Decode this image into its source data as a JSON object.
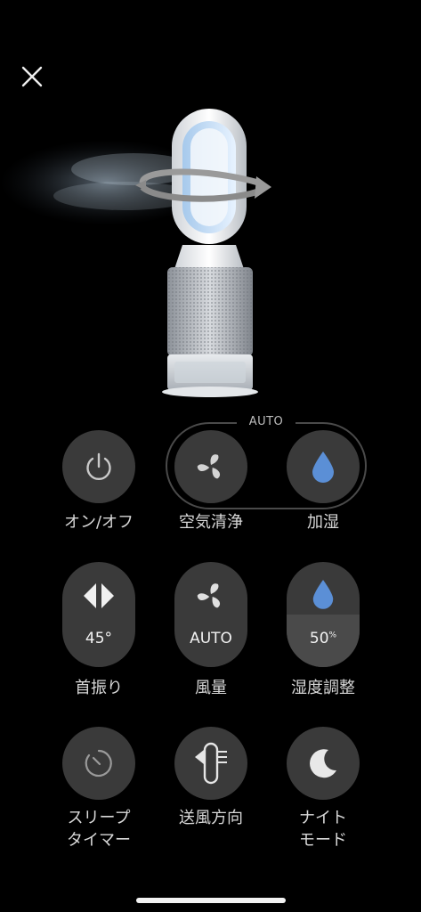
{
  "colors": {
    "background": "#000000",
    "button": "#3a3a3a",
    "accent_blue": "#5b8fd6",
    "label": "#d8d8d8"
  },
  "header": {
    "close_icon": "close-icon"
  },
  "auto_group": {
    "label": "AUTO"
  },
  "controls": {
    "power": {
      "label": "オン/オフ",
      "icon": "power-icon"
    },
    "purify": {
      "label": "空気清浄",
      "icon": "fan-icon"
    },
    "humidify": {
      "label": "加湿",
      "icon": "water-drop-icon"
    },
    "oscillation": {
      "label": "首振り",
      "value": "45°",
      "icon": "oscillation-arrows-icon"
    },
    "airflow": {
      "label": "風量",
      "value": "AUTO",
      "icon": "fan-icon"
    },
    "humidity": {
      "label": "湿度調整",
      "value": "50",
      "unit": "%",
      "level": 0.5,
      "icon": "water-drop-icon"
    },
    "sleep_timer": {
      "label": "スリープ\nタイマー",
      "icon": "timer-icon"
    },
    "airflow_direction": {
      "label": "送風方向",
      "icon": "airflow-direction-icon"
    },
    "night_mode": {
      "label": "ナイト\nモード",
      "icon": "moon-icon"
    }
  }
}
